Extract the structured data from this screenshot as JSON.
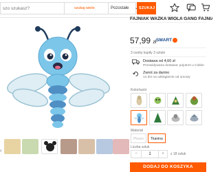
{
  "header": {
    "search_text": "szo szukasz?",
    "search_scope": "szukaj wiele",
    "category": "Pozostałe",
    "search_button": "SZUKAJ"
  },
  "product": {
    "title": "FAJNIAK WAŻKA WIOLA GANG FAJNIAKÓW",
    "price": "57,99",
    "currency": "zł",
    "smart_label": "SMART",
    "bought": "3 osoby kupiły 3 sztuki",
    "delivery_line1": "Dostawa od 4,60 zł",
    "delivery_line2": "Przewidywana dostawa: pojutrze u Ciebie",
    "return_line1": "Zwrot za darmo",
    "return_line2": "14 dni na odstąpienie od umowy",
    "colors_label": "Kolor/wzór",
    "material_label": "Materiał",
    "materials": [
      "Pluszo",
      "Tkanina"
    ],
    "quantity_label": "Liczba sztuk",
    "quantity_value": "1",
    "quantity_available": "z 18 sztuk",
    "add_to_cart": "DODAJ DO KOSZYKA"
  },
  "colors": {
    "accent": "#ff5a00",
    "smart_blue": "#1a4b8c",
    "muted_text": "#767676"
  },
  "icons": {
    "star": "star-icon",
    "messages": "chat-icon",
    "cart": "cart-icon",
    "delivery": "truck-icon",
    "return": "return-icon"
  }
}
